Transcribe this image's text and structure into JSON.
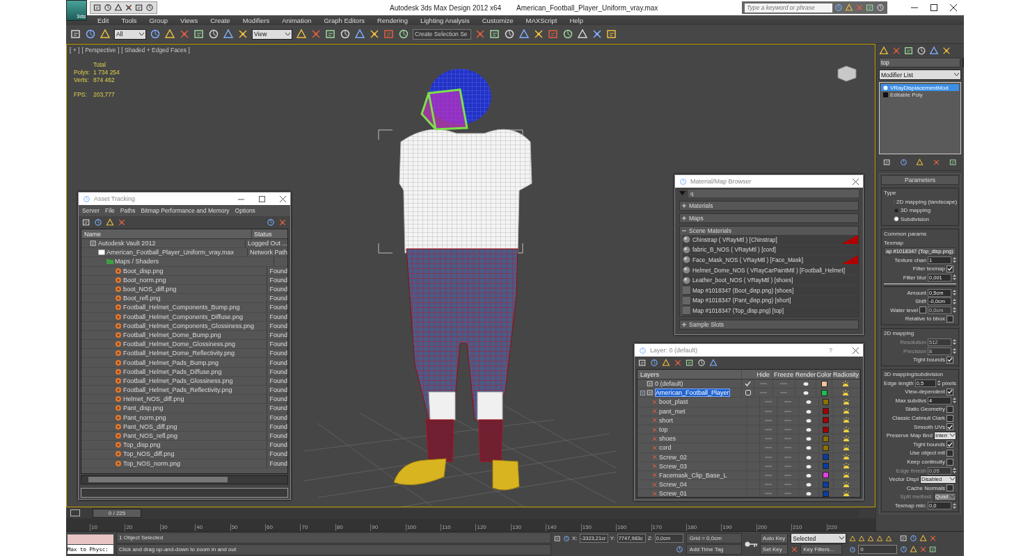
{
  "title_bar": {
    "app_logo": "3ds",
    "title": "Autodesk 3ds Max Design 2012 x64",
    "file": "American_Football_Player_Uniform_vray.max",
    "search": {
      "placeholder": "Type a keyword or phrase"
    }
  },
  "menu": [
    "Edit",
    "Tools",
    "Group",
    "Views",
    "Create",
    "Modifiers",
    "Animation",
    "Graph Editors",
    "Rendering",
    "Lighting Analysis",
    "Customize",
    "MAXScript",
    "Help"
  ],
  "toolbar": {
    "selection_filter": "All",
    "reference_coordinate": "View",
    "named_selection": "Create Selection Se"
  },
  "viewport": {
    "labels": [
      "[ + ]",
      "[ Perspective ]",
      "[ Shaded + Edged Faces ]"
    ],
    "stats_header": "Total",
    "stats": [
      {
        "label": "Polys:",
        "value": "1 734 254"
      },
      {
        "label": "Verts:",
        "value": "874 462"
      }
    ],
    "fps_label": "FPS:",
    "fps": "203,777"
  },
  "asset_tracking": {
    "title": "Asset Tracking",
    "menu": [
      "Server",
      "File",
      "Paths",
      "Bitmap Performance and Memory",
      "Options"
    ],
    "columns": [
      "Name",
      "Status"
    ],
    "rows": [
      {
        "name": "Autodesk Vault 2012",
        "status": "Logged Out ...",
        "kind": "vault",
        "children": [
          {
            "name": "American_Football_Player_Uniform_vray.max",
            "status": "Network Path",
            "kind": "file",
            "children": [
              {
                "name": "Maps / Shaders",
                "kind": "folder",
                "children": [
                  {
                    "name": "Boot_disp.png",
                    "status": "Found",
                    "kind": "map"
                  },
                  {
                    "name": "Boot_norm.png",
                    "status": "Found",
                    "kind": "map"
                  },
                  {
                    "name": "boot_NOS_diff.png",
                    "status": "Found",
                    "kind": "map"
                  },
                  {
                    "name": "Boot_refl.png",
                    "status": "Found",
                    "kind": "map"
                  },
                  {
                    "name": "Football_Helmet_Components_Bump.png",
                    "status": "Found",
                    "kind": "map"
                  },
                  {
                    "name": "Football_Helmet_Components_Diffuse.png",
                    "status": "Found",
                    "kind": "map"
                  },
                  {
                    "name": "Football_Helmet_Components_Glossiness.png",
                    "status": "Found",
                    "kind": "map"
                  },
                  {
                    "name": "Football_Helmet_Dome_Bump.png",
                    "status": "Found",
                    "kind": "map"
                  },
                  {
                    "name": "Football_Helmet_Dome_Glossiness.png",
                    "status": "Found",
                    "kind": "map"
                  },
                  {
                    "name": "Football_Helmet_Dome_Reflectivity.png",
                    "status": "Found",
                    "kind": "map"
                  },
                  {
                    "name": "Football_Helmet_Pads_Bump.png",
                    "status": "Found",
                    "kind": "map"
                  },
                  {
                    "name": "Football_Helmet_Pads_Diffuse.png",
                    "status": "Found",
                    "kind": "map"
                  },
                  {
                    "name": "Football_Helmet_Pads_Glossiness.png",
                    "status": "Found",
                    "kind": "map"
                  },
                  {
                    "name": "Football_Helmet_Pads_Reflectivity.png",
                    "status": "Found",
                    "kind": "map"
                  },
                  {
                    "name": "Helmet_NOS_diff.png",
                    "status": "Found",
                    "kind": "map"
                  },
                  {
                    "name": "Pant_disp.png",
                    "status": "Found",
                    "kind": "map"
                  },
                  {
                    "name": "Pant_norm.png",
                    "status": "Found",
                    "kind": "map"
                  },
                  {
                    "name": "Pant_NOS_diff.png",
                    "status": "Found",
                    "kind": "map"
                  },
                  {
                    "name": "Pant_NOS_refl.png",
                    "status": "Found",
                    "kind": "map"
                  },
                  {
                    "name": "Top_disp.png",
                    "status": "Found",
                    "kind": "map"
                  },
                  {
                    "name": "Top_NOS_diff.png",
                    "status": "Found",
                    "kind": "map"
                  },
                  {
                    "name": "Top_NOS_norm.png",
                    "status": "Found",
                    "kind": "map"
                  }
                ]
              }
            ]
          }
        ]
      }
    ]
  },
  "material_browser": {
    "title": "Material/Map Browser",
    "search": "q",
    "groups": [
      {
        "label": "Materials",
        "expanded": false
      },
      {
        "label": "Maps",
        "expanded": false
      },
      {
        "label": "Scene Materials",
        "expanded": true,
        "items": [
          {
            "label": "Chinstrap  ( VRayMtl )  [Chinstrap]",
            "kind": "material",
            "flagged": true
          },
          {
            "label": "fabric_B_NOS  ( VRayMtl )  [cord]",
            "kind": "material",
            "flagged": false
          },
          {
            "label": "Face_Mask_NOS  ( VRayMtl )  [Face_Mask]",
            "kind": "material",
            "flagged": true
          },
          {
            "label": "Helmet_Dome_NOS  ( VRayCarPaintMtl )  [Football_Helmet]",
            "kind": "material",
            "flagged": false
          },
          {
            "label": "Leather_boot_NOS  ( VRayMtl )  [shoes]",
            "kind": "material",
            "flagged": false
          },
          {
            "label": "Map #1018347 (Boot_disp.png)  [shoes]",
            "kind": "map",
            "flagged": false
          },
          {
            "label": "Map #1018347 (Pant_disp.png)  [short]",
            "kind": "map",
            "flagged": false
          },
          {
            "label": "Map #1018347 (Top_disp.png)  [top]",
            "kind": "map",
            "flagged": false
          }
        ]
      },
      {
        "label": "Sample Slots",
        "expanded": false
      }
    ]
  },
  "layer_manager": {
    "title": "Layer: 0 (default)",
    "help": "?",
    "columns": [
      "Layers",
      "Hide",
      "Freeze",
      "Render",
      "Color",
      "Radiosity"
    ],
    "layers": [
      {
        "name": "0 (default)",
        "current": true,
        "selected": false,
        "color": "#f2c49c"
      },
      {
        "name": "American_Football_Player",
        "current": false,
        "selected": true,
        "expanded": true,
        "color": "#1fbf4f",
        "children": [
          {
            "name": "boot_plast",
            "selected": false,
            "color": "#8c7000"
          },
          {
            "name": "pant_met",
            "selected": false,
            "color": "#a00000"
          },
          {
            "name": "short",
            "selected": false,
            "color": "#a00000"
          },
          {
            "name": "top",
            "selected": false,
            "color": "#a00000"
          },
          {
            "name": "shoes",
            "selected": false,
            "color": "#8c7000"
          },
          {
            "name": "cord",
            "selected": false,
            "color": "#8c7000"
          },
          {
            "name": "Screw_02",
            "selected": false,
            "color": "#0a3d9c"
          },
          {
            "name": "Screw_03",
            "selected": false,
            "color": "#0a3d9c"
          },
          {
            "name": "Facemask_Clip_Base_L",
            "selected": false,
            "color": "#e040e0"
          },
          {
            "name": "Screw_04",
            "selected": false,
            "color": "#0a3d9c"
          },
          {
            "name": "Screw_01",
            "selected": false,
            "color": "#0a3d9c"
          }
        ]
      }
    ]
  },
  "command_panel": {
    "object_name": "top",
    "modifier_list": "Modifier List",
    "stack": [
      {
        "label": "VRayDisplacementMod",
        "selected": true,
        "kind": "modifier"
      },
      {
        "label": "Editable Poly",
        "selected": false,
        "kind": "base"
      }
    ],
    "rollout": "Parameters",
    "groups": [
      {
        "title": "Type",
        "rows": [
          {
            "kind": "radio",
            "label": "2D mapping (landscape)",
            "selected": false
          },
          {
            "kind": "radio",
            "label": "3D mapping",
            "selected": false
          },
          {
            "kind": "radio",
            "label": "Subdivision",
            "selected": true
          }
        ]
      },
      {
        "title": "Common params",
        "rows": [
          {
            "kind": "label",
            "label": "Texmap"
          },
          {
            "kind": "button",
            "value": "ap #1018347 (Top_disp.png)"
          },
          {
            "kind": "spinner",
            "label": "Texture chan",
            "value": "1",
            "disabled": false
          },
          {
            "kind": "check",
            "label": "Filter texmap",
            "checked": true,
            "disabled": false
          },
          {
            "kind": "spinner",
            "label": "Filter blur",
            "value": "0,001",
            "disabled": false
          },
          {
            "kind": "separator"
          },
          {
            "kind": "spinner",
            "label": "Amount",
            "value": "0,5cm",
            "disabled": false
          },
          {
            "kind": "spinner",
            "label": "Shift",
            "value": "-0,0cm",
            "disabled": false
          },
          {
            "kind": "check_spinner",
            "label": "Water level",
            "checked": false,
            "value": "0,0cm",
            "disabled": true
          },
          {
            "kind": "check",
            "label": "Relative to bbox",
            "checked": false,
            "disabled": false
          }
        ]
      },
      {
        "title": "2D mapping",
        "rows": [
          {
            "kind": "spinner",
            "label": "Resolution",
            "value": "512",
            "disabled": true
          },
          {
            "kind": "spinner",
            "label": "Precision",
            "value": "8",
            "disabled": true
          },
          {
            "kind": "check",
            "label": "Tight bounds",
            "checked": true,
            "disabled": false
          }
        ]
      },
      {
        "title": "3D mapping/subdivision",
        "rows": [
          {
            "kind": "spinner",
            "label": "Edge length",
            "value": "0,5",
            "unit": "pixels",
            "disabled": false
          },
          {
            "kind": "check",
            "label": "View-dependent",
            "checked": true,
            "disabled": false
          },
          {
            "kind": "spinner",
            "label": "Max subdivs",
            "value": "4",
            "disabled": false
          },
          {
            "kind": "check",
            "label": "Static Geometry",
            "checked": false,
            "disabled": false
          },
          {
            "kind": "check",
            "label": "Classic Catmull Clark",
            "checked": false,
            "disabled": false
          },
          {
            "kind": "check",
            "label": "Smooth UVs",
            "checked": true,
            "disabled": false
          },
          {
            "kind": "dropdown",
            "label": "Preserve Map Bnd",
            "value": "Interr",
            "disabled": false
          },
          {
            "kind": "check",
            "label": "Tight bounds",
            "checked": true,
            "disabled": false
          },
          {
            "kind": "check",
            "label": "Use object mtl",
            "checked": false,
            "disabled": false
          },
          {
            "kind": "check",
            "label": "Keep continuity",
            "checked": false,
            "disabled": false
          },
          {
            "kind": "spinner",
            "label": "Edge thresh",
            "value": "0,05",
            "disabled": true
          },
          {
            "kind": "dropdown",
            "label": "Vector Displ",
            "value": "Disabled",
            "disabled": false
          },
          {
            "kind": "check",
            "label": "Cache Normals",
            "checked": false,
            "disabled": false
          },
          {
            "kind": "dropdown",
            "label": "Split method:",
            "value": "Quad",
            "disabled": true
          },
          {
            "kind": "spinner",
            "label": "Texmap min:",
            "value": "0,0",
            "disabled": false
          }
        ]
      }
    ]
  },
  "timeline": {
    "frame_label": "0 / 225",
    "level": 0,
    "ticks": [
      "10",
      "20",
      "30",
      "40",
      "50",
      "60",
      "70",
      "80",
      "90",
      "100",
      "110",
      "120",
      "130",
      "140",
      "150",
      "160",
      "170",
      "180",
      "190",
      "200",
      "210",
      "220"
    ]
  },
  "status_bar": {
    "listener": "Max to Physc:",
    "selection": "1 Object Selected",
    "prompt": "Click and drag up-and-down to zoom in and out",
    "coords": [
      {
        "label": "X:",
        "value": "-3323,21cr"
      },
      {
        "label": "Y:",
        "value": "7747,983c"
      },
      {
        "label": "Z:",
        "value": "0,0cm"
      }
    ],
    "grid": "Grid = 0,0cm",
    "add_time_tag": "Add Time Tag",
    "auto_key": "Auto Key",
    "key_mode": "Selected",
    "set_key": "Set Key",
    "key_filters": "Key Filters...",
    "frame": "0"
  }
}
